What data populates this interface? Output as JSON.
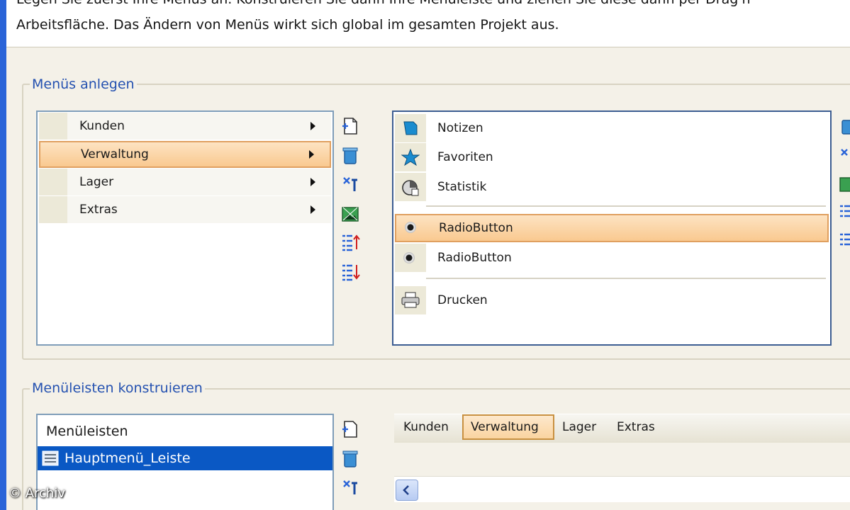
{
  "intro": {
    "line1": "Legen Sie zuerst Ihre Menüs an. Konstruieren Sie dann Ihre Menüleiste und ziehen Sie diese dann per Drag'n'",
    "line2": "Arbeitsfläche. Das Ändern von Menüs wirkt sich global im gesamten Projekt aus."
  },
  "menus_section": {
    "title": "Menüs anlegen",
    "menu_list": [
      {
        "label": "Kunden"
      },
      {
        "label": "Verwaltung"
      },
      {
        "label": "Lager"
      },
      {
        "label": "Extras"
      }
    ],
    "selected_menu": "Verwaltung",
    "submenu_items": [
      {
        "label": "Notizen",
        "icon": "notes-icon"
      },
      {
        "label": "Favoriten",
        "icon": "star-icon"
      },
      {
        "label": "Statistik",
        "icon": "statistics-icon"
      },
      {
        "label": "RadioButton",
        "icon": "radio-icon"
      },
      {
        "label": "RadioButton",
        "icon": "radio-icon"
      },
      {
        "label": "Drucken",
        "icon": "printer-icon"
      }
    ],
    "selected_submenu_index": 3
  },
  "menubar_section": {
    "title": "Menüleisten konstruieren",
    "list_header": "Menüleisten",
    "bars": [
      {
        "label": "Hauptmenü_Leiste"
      }
    ],
    "preview_tabs": [
      {
        "label": "Kunden"
      },
      {
        "label": "Verwaltung"
      },
      {
        "label": "Lager"
      },
      {
        "label": "Extras"
      }
    ],
    "selected_tab": "Verwaltung"
  },
  "toolbar_icons": [
    "new-icon",
    "delete-icon",
    "properties-icon",
    "image-icon",
    "move-up-icon",
    "move-down-icon"
  ],
  "watermark": "© Archiv",
  "colors": {
    "accent": "#2451b0",
    "selection": "#0a58c4",
    "highlight": "#f9c990",
    "background": "#f4f1e8"
  }
}
